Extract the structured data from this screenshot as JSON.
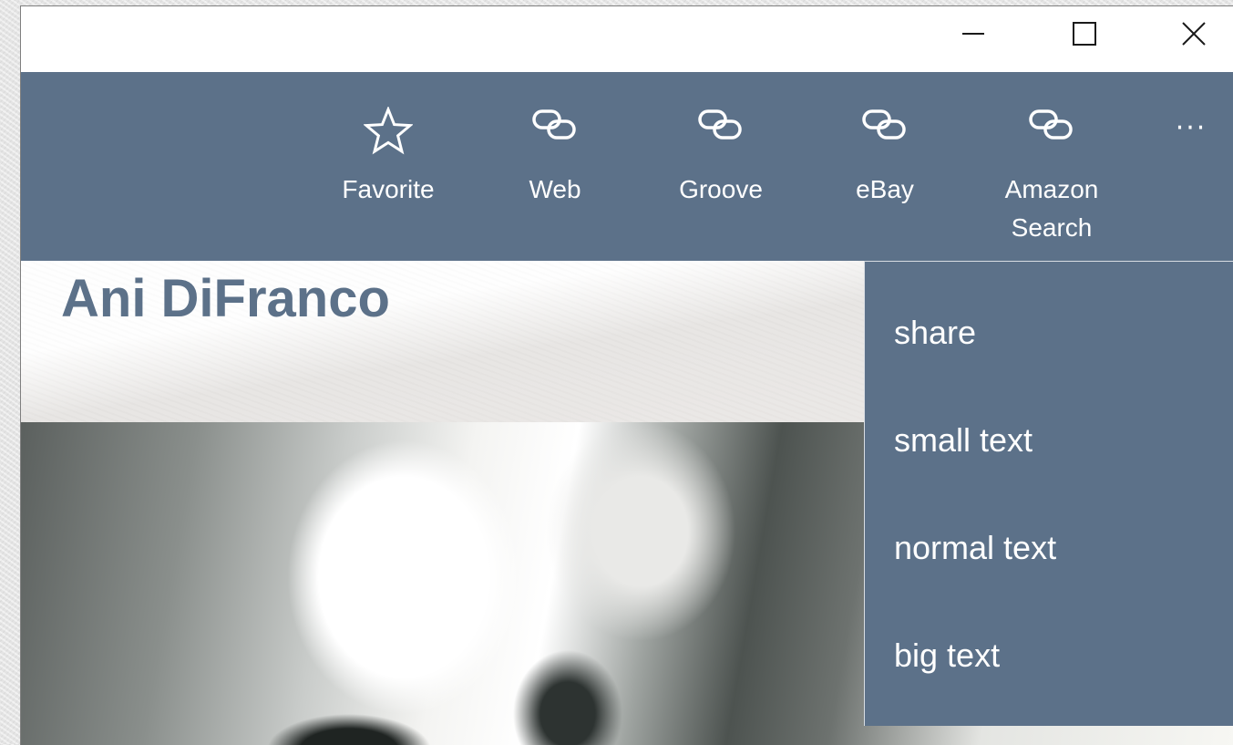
{
  "window": {
    "controls": {
      "minimize_icon": "minimize-icon",
      "maximize_icon": "maximize-icon",
      "close_icon": "close-icon"
    }
  },
  "toolbar": {
    "commands": [
      {
        "label": "Favorite",
        "icon": "star-icon"
      },
      {
        "label": "Web",
        "icon": "link-icon"
      },
      {
        "label": "Groove",
        "icon": "link-icon"
      },
      {
        "label": "eBay",
        "icon": "link-icon"
      },
      {
        "label": "Amazon Search",
        "icon": "link-icon"
      }
    ],
    "more_label": "···"
  },
  "content": {
    "title": "Ani DiFranco"
  },
  "overflow_menu": {
    "items": [
      "share",
      "small text",
      "normal text",
      "big text"
    ]
  },
  "colors": {
    "accent": "#5c7189",
    "title_text": "#5c7189",
    "menu_text": "#ffffff"
  }
}
